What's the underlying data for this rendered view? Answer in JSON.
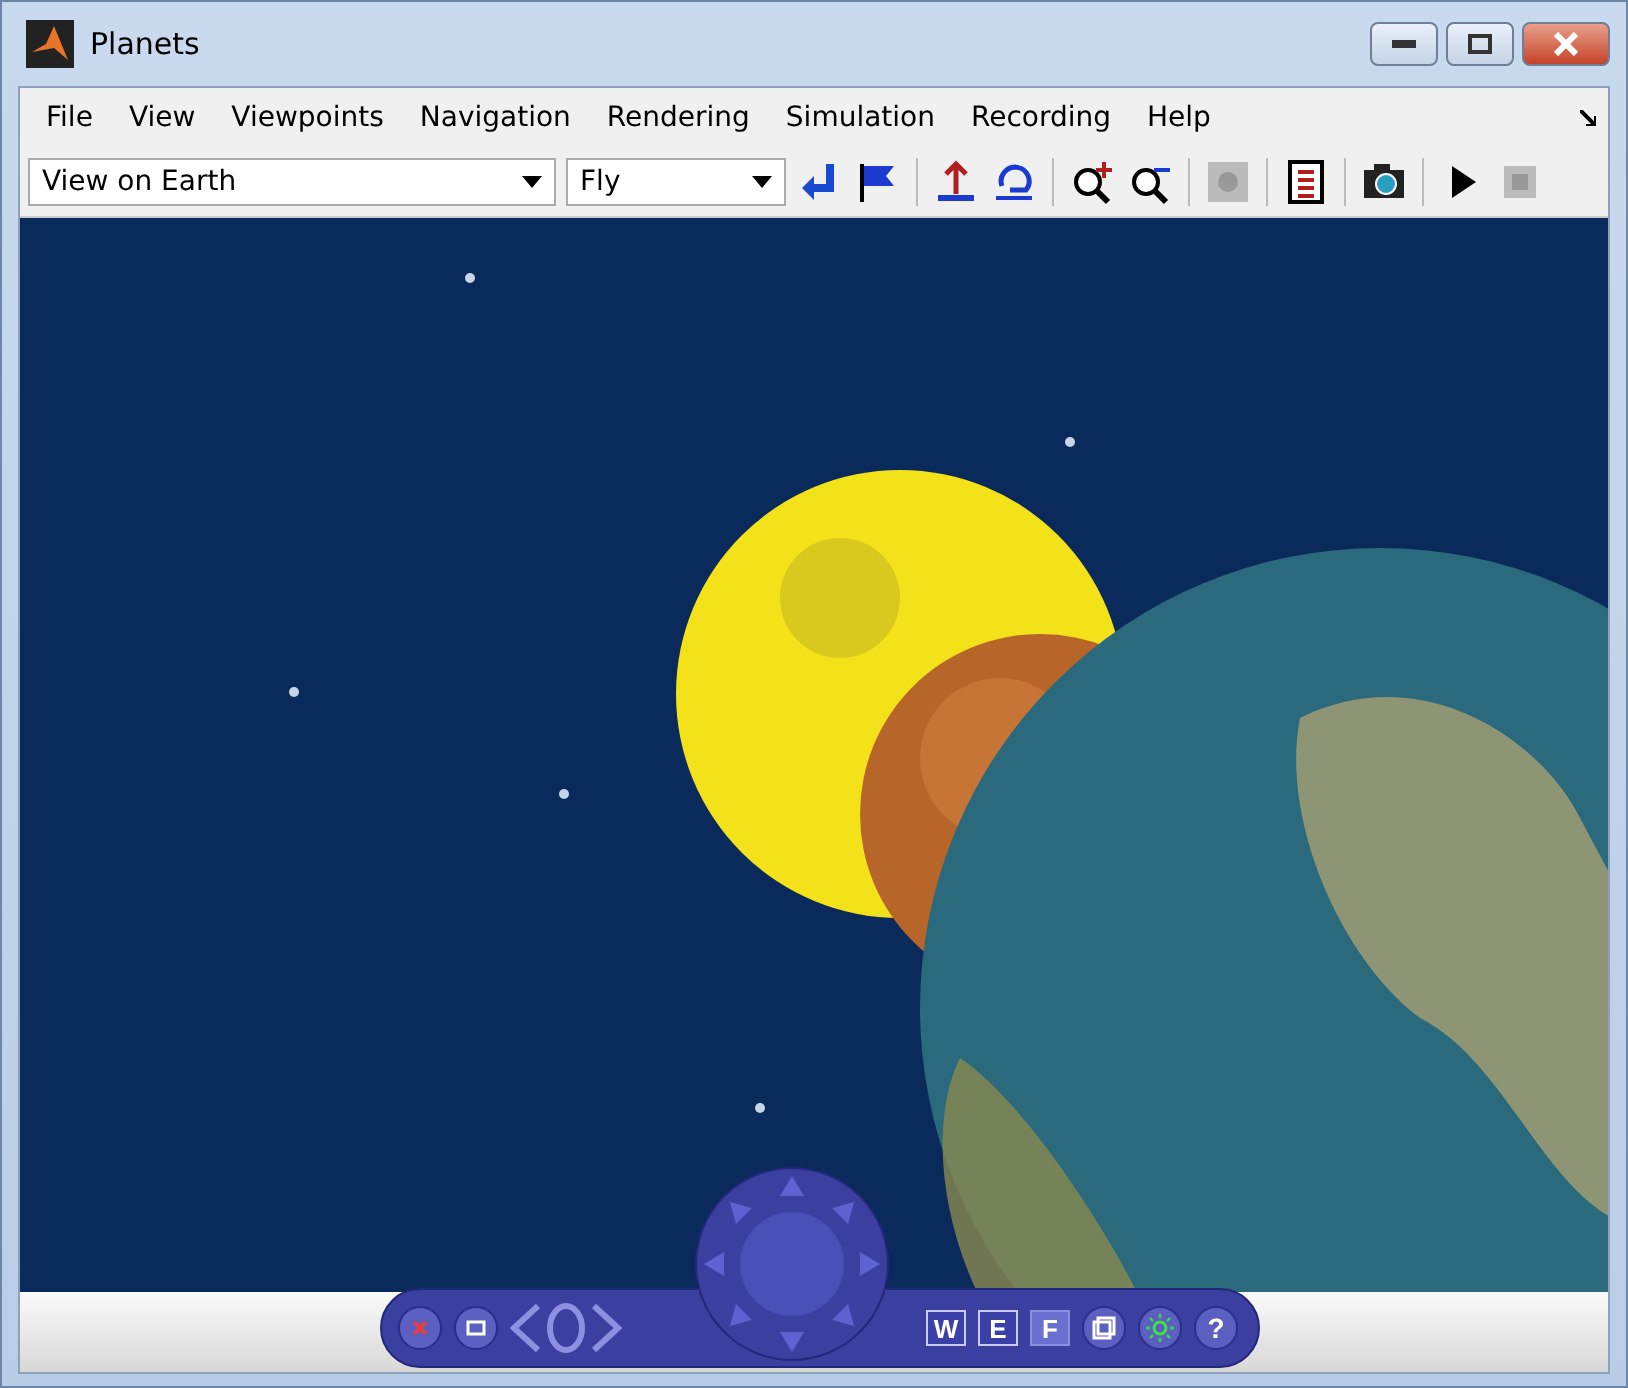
{
  "window": {
    "title": "Planets"
  },
  "menu": [
    "File",
    "View",
    "Viewpoints",
    "Navigation",
    "Rendering",
    "Simulation",
    "Recording",
    "Help"
  ],
  "toolbar": {
    "viewpoint": "View on Earth",
    "navigation_mode": "Fly"
  },
  "nav_panel": {
    "views": [
      {
        "label": "W",
        "selected": false
      },
      {
        "label": "E",
        "selected": false
      },
      {
        "label": "F",
        "selected": true
      }
    ],
    "help": "?"
  }
}
